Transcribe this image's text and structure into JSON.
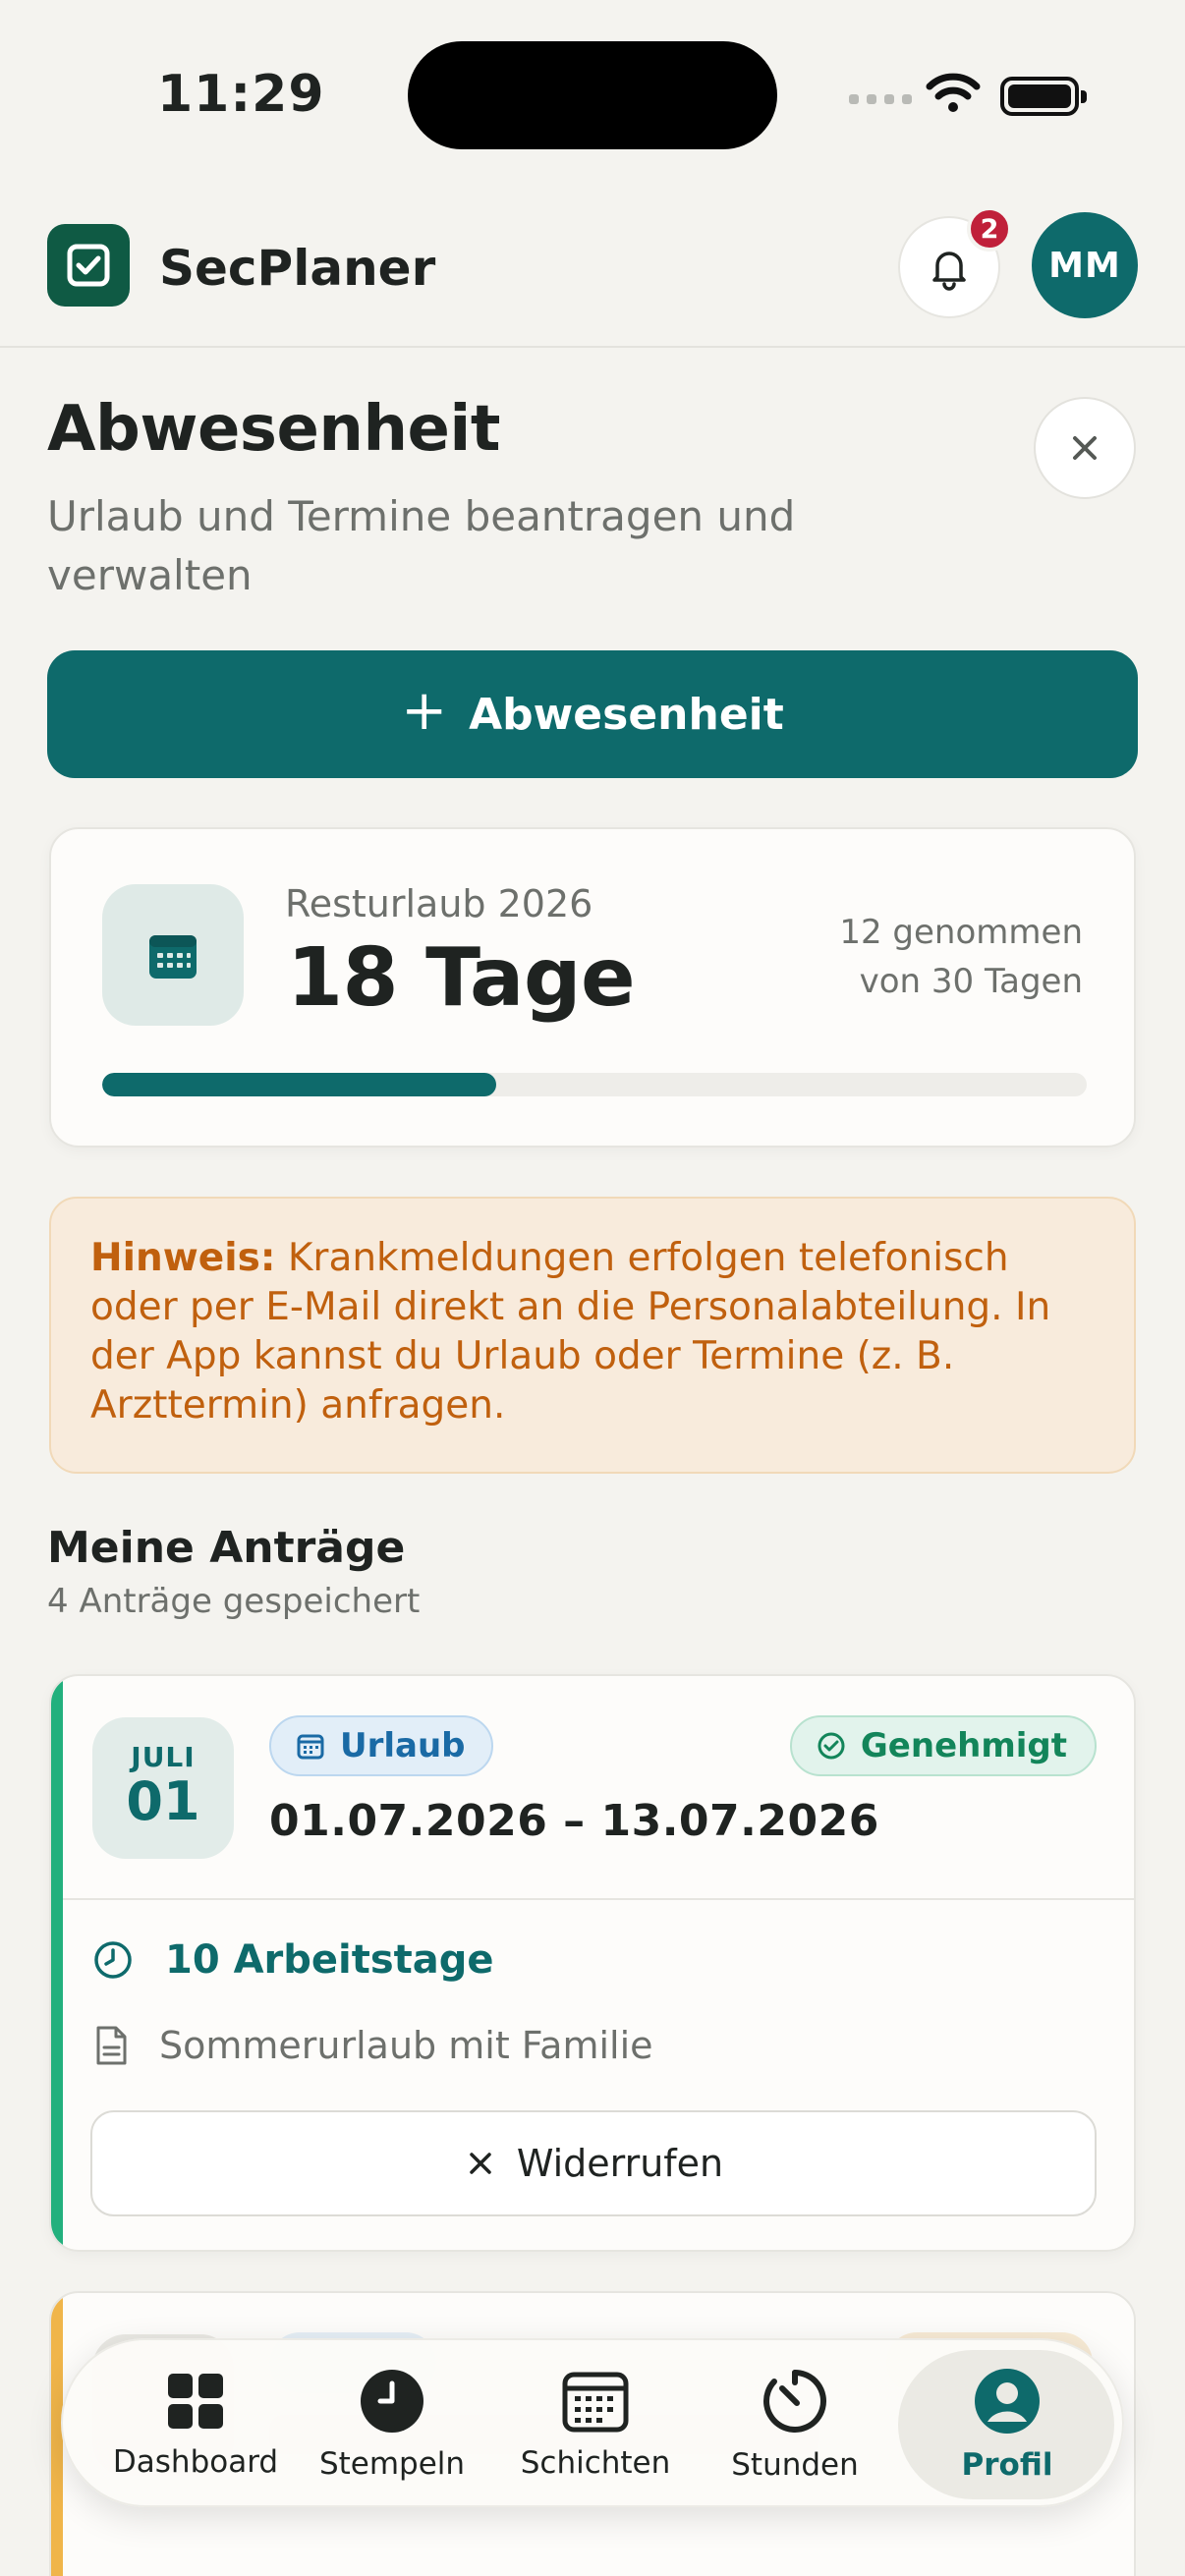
{
  "status_bar": {
    "time": "11:29"
  },
  "app": {
    "name": "SecPlaner",
    "notification_count": "2",
    "avatar_initials": "MM"
  },
  "page": {
    "title": "Abwesenheit",
    "subtitle": "Urlaub und Termine beantragen und verwalten"
  },
  "actions": {
    "add_label": "Abwesenheit",
    "add_icon": "+"
  },
  "leave": {
    "label": "Resturlaub 2026",
    "value": "18 Tage",
    "taken": "12 genommen",
    "of_total": "von 30 Tagen",
    "progress_fraction": 0.4
  },
  "notice": {
    "prefix": "Hinweis:",
    "text": " Krankmeldungen erfolgen telefonisch oder per E-Mail direkt an die Personalabteilung. In der App kannst du Urlaub oder Termine (z. B. Arzttermin) anfragen."
  },
  "requests_section": {
    "title": "Meine Anträge",
    "count_text": "4 Anträge gespeichert"
  },
  "requests": [
    {
      "month": "JULI",
      "day": "01",
      "type": "Urlaub",
      "status": "Genehmigt",
      "date_range": "01.07.2026 – 13.07.2026",
      "workdays": "10 Arbeitstage",
      "note": "Sommerurlaub mit Familie",
      "withdraw_label": "Widerrufen"
    }
  ],
  "tabs": [
    {
      "label": "Dashboard",
      "icon": "dashboard-icon"
    },
    {
      "label": "Stempeln",
      "icon": "clock-icon"
    },
    {
      "label": "Schichten",
      "icon": "calendar-icon"
    },
    {
      "label": "Stunden",
      "icon": "timer-icon"
    },
    {
      "label": "Profil",
      "icon": "profile-icon",
      "active": true
    }
  ],
  "colors": {
    "primary": "#0e6a6b",
    "brand": "#0f5a44",
    "approved": "#13855a",
    "notice": "#c0600e",
    "badge": "#c0203a"
  }
}
